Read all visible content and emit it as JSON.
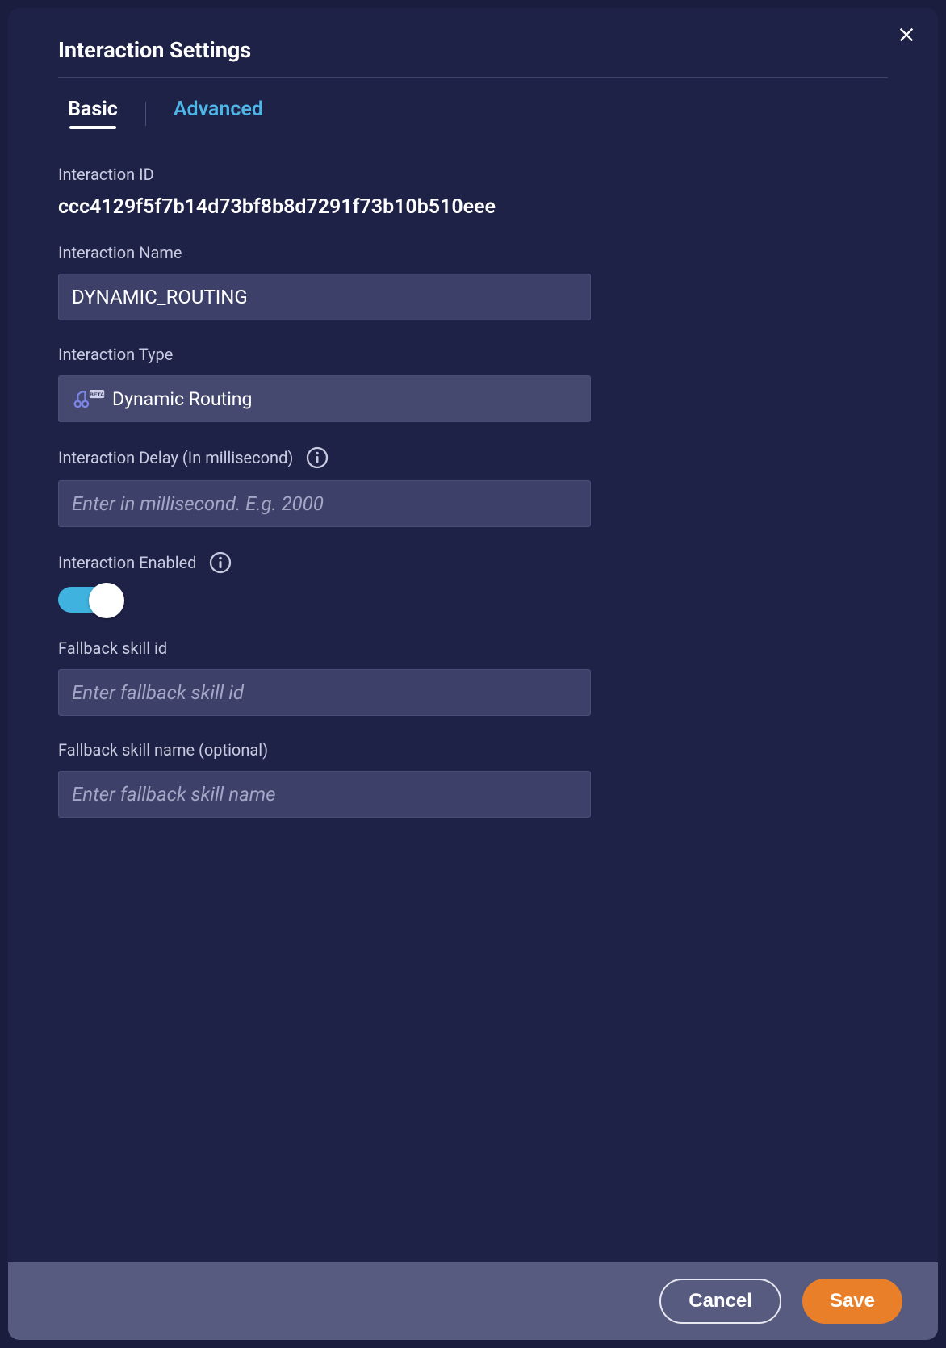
{
  "header": {
    "title": "Interaction Settings"
  },
  "tabs": {
    "basic": "Basic",
    "advanced": "Advanced"
  },
  "fields": {
    "interaction_id": {
      "label": "Interaction ID",
      "value": "ccc4129f5f7b14d73bf8b8d7291f73b10b510eee"
    },
    "interaction_name": {
      "label": "Interaction Name",
      "value": "DYNAMIC_ROUTING"
    },
    "interaction_type": {
      "label": "Interaction Type",
      "selected": "Dynamic Routing",
      "badge": "BETA",
      "icon": "routing-icon"
    },
    "interaction_delay": {
      "label": "Interaction Delay (In millisecond)",
      "placeholder": "Enter in millisecond. E.g. 2000",
      "value": ""
    },
    "interaction_enabled": {
      "label": "Interaction Enabled",
      "value": true
    },
    "fallback_skill_id": {
      "label": "Fallback skill id",
      "placeholder": "Enter fallback skill id",
      "value": ""
    },
    "fallback_skill_name": {
      "label": "Fallback skill name (optional)",
      "placeholder": "Enter fallback skill name",
      "value": ""
    }
  },
  "footer": {
    "cancel": "Cancel",
    "save": "Save"
  }
}
